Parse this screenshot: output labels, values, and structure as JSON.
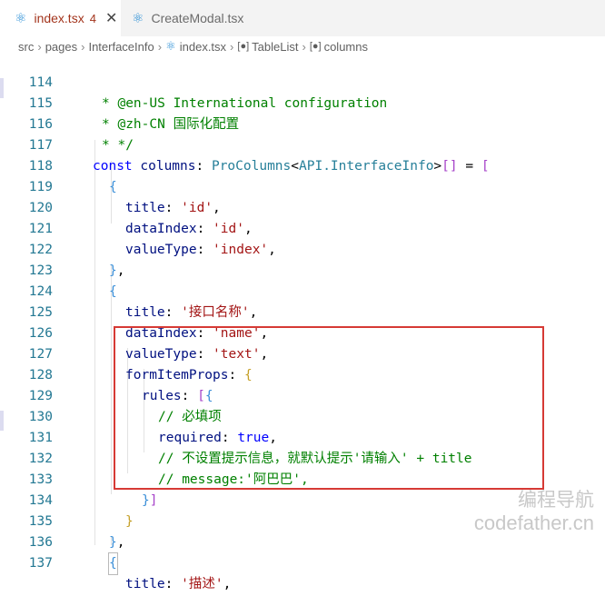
{
  "tabs": [
    {
      "label": "index.tsx",
      "badge": "4",
      "close": "✕",
      "active": true
    },
    {
      "label": "CreateModal.tsx",
      "active": false
    }
  ],
  "breadcrumb": [
    "src",
    "pages",
    "InterfaceInfo",
    "index.tsx",
    "TableList",
    "columns"
  ],
  "code": {
    "l114": {
      "n": "114",
      "t": "* @en-US International configuration"
    },
    "l115": {
      "n": "115",
      "t": "* @zh-CN 国际化配置"
    },
    "l116": {
      "n": "116",
      "t": "* */"
    },
    "l117": {
      "n": "117",
      "kw": "const",
      "id": "columns",
      "ty": "ProColumns",
      "ty2": "API.InterfaceInfo",
      "eq": "= "
    },
    "l118": {
      "n": "118"
    },
    "l119": {
      "n": "119",
      "key": "title",
      "val": "'id'"
    },
    "l120": {
      "n": "120",
      "key": "dataIndex",
      "val": "'id'"
    },
    "l121": {
      "n": "121",
      "key": "valueType",
      "val": "'index'"
    },
    "l122": {
      "n": "122"
    },
    "l123": {
      "n": "123"
    },
    "l124": {
      "n": "124",
      "key": "title",
      "val": "'接口名称'"
    },
    "l125": {
      "n": "125",
      "key": "dataIndex",
      "val": "'name'"
    },
    "l126": {
      "n": "126",
      "key": "valueType",
      "val": "'text'"
    },
    "l127": {
      "n": "127",
      "key": "formItemProps"
    },
    "l128": {
      "n": "128",
      "key": "rules"
    },
    "l129": {
      "n": "129",
      "t": "// 必填项"
    },
    "l130": {
      "n": "130",
      "key": "required",
      "val": "true"
    },
    "l131": {
      "n": "131",
      "t": "// 不设置提示信息，就默认提示'请输入' + title"
    },
    "l132": {
      "n": "132",
      "t": "// message:'阿巴巴',"
    },
    "l133": {
      "n": "133"
    },
    "l134": {
      "n": "134"
    },
    "l135": {
      "n": "135"
    },
    "l136": {
      "n": "136"
    },
    "l137": {
      "n": "137",
      "key": "title",
      "val": "'描述'"
    }
  },
  "watermark": {
    "line1": "编程导航",
    "line2": "codefather.cn"
  }
}
